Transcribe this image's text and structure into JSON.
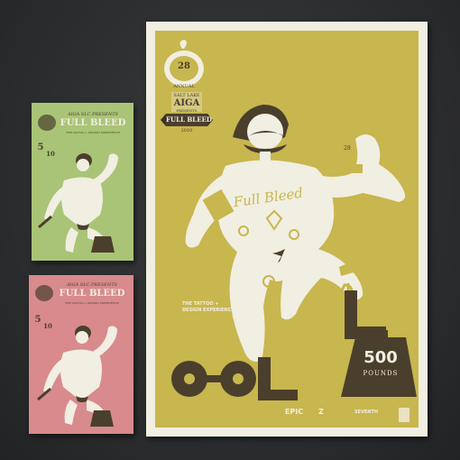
{
  "poster": {
    "badge_number": "28",
    "badge_sub": "ANNUAL",
    "presenter_line1": "SALT LAKE",
    "presenter_line2": "AIGA",
    "presenter_line3": "PRESENTS",
    "banner": "FULL BLEED",
    "year": "2010",
    "chest_script": "Full Bleed",
    "heart_number": "28",
    "sign_text": "500",
    "sign_sub": "POUNDS",
    "tagline_line1": "THE TATTOO +",
    "tagline_line2": "DESIGN EXPERIENCE",
    "sponsor_1": "EPIC",
    "sponsor_2": "Z",
    "sponsor_3": "SEVENTH"
  },
  "card_green": {
    "header_line1": "AIGA SLC PRESENTS",
    "header_line2": "FULL BLEED",
    "header_line3": "THE TATTOO + DESIGN EXPERIENCE",
    "date_num": "5",
    "date_den": "10"
  },
  "card_pink": {
    "header_line1": "AIGA SLC PRESENTS",
    "header_line2": "FULL BLEED",
    "header_line3": "THE TATTOO + DESIGN EXPERIENCE",
    "date_num": "5",
    "date_den": "10"
  },
  "colors": {
    "background": "#2c2d2f",
    "poster_mustard": "#c8b64e",
    "ink_brown": "#4a3f2c",
    "card_green": "#a9c476",
    "card_pink": "#d88a8c",
    "paper": "#f1eee2"
  }
}
